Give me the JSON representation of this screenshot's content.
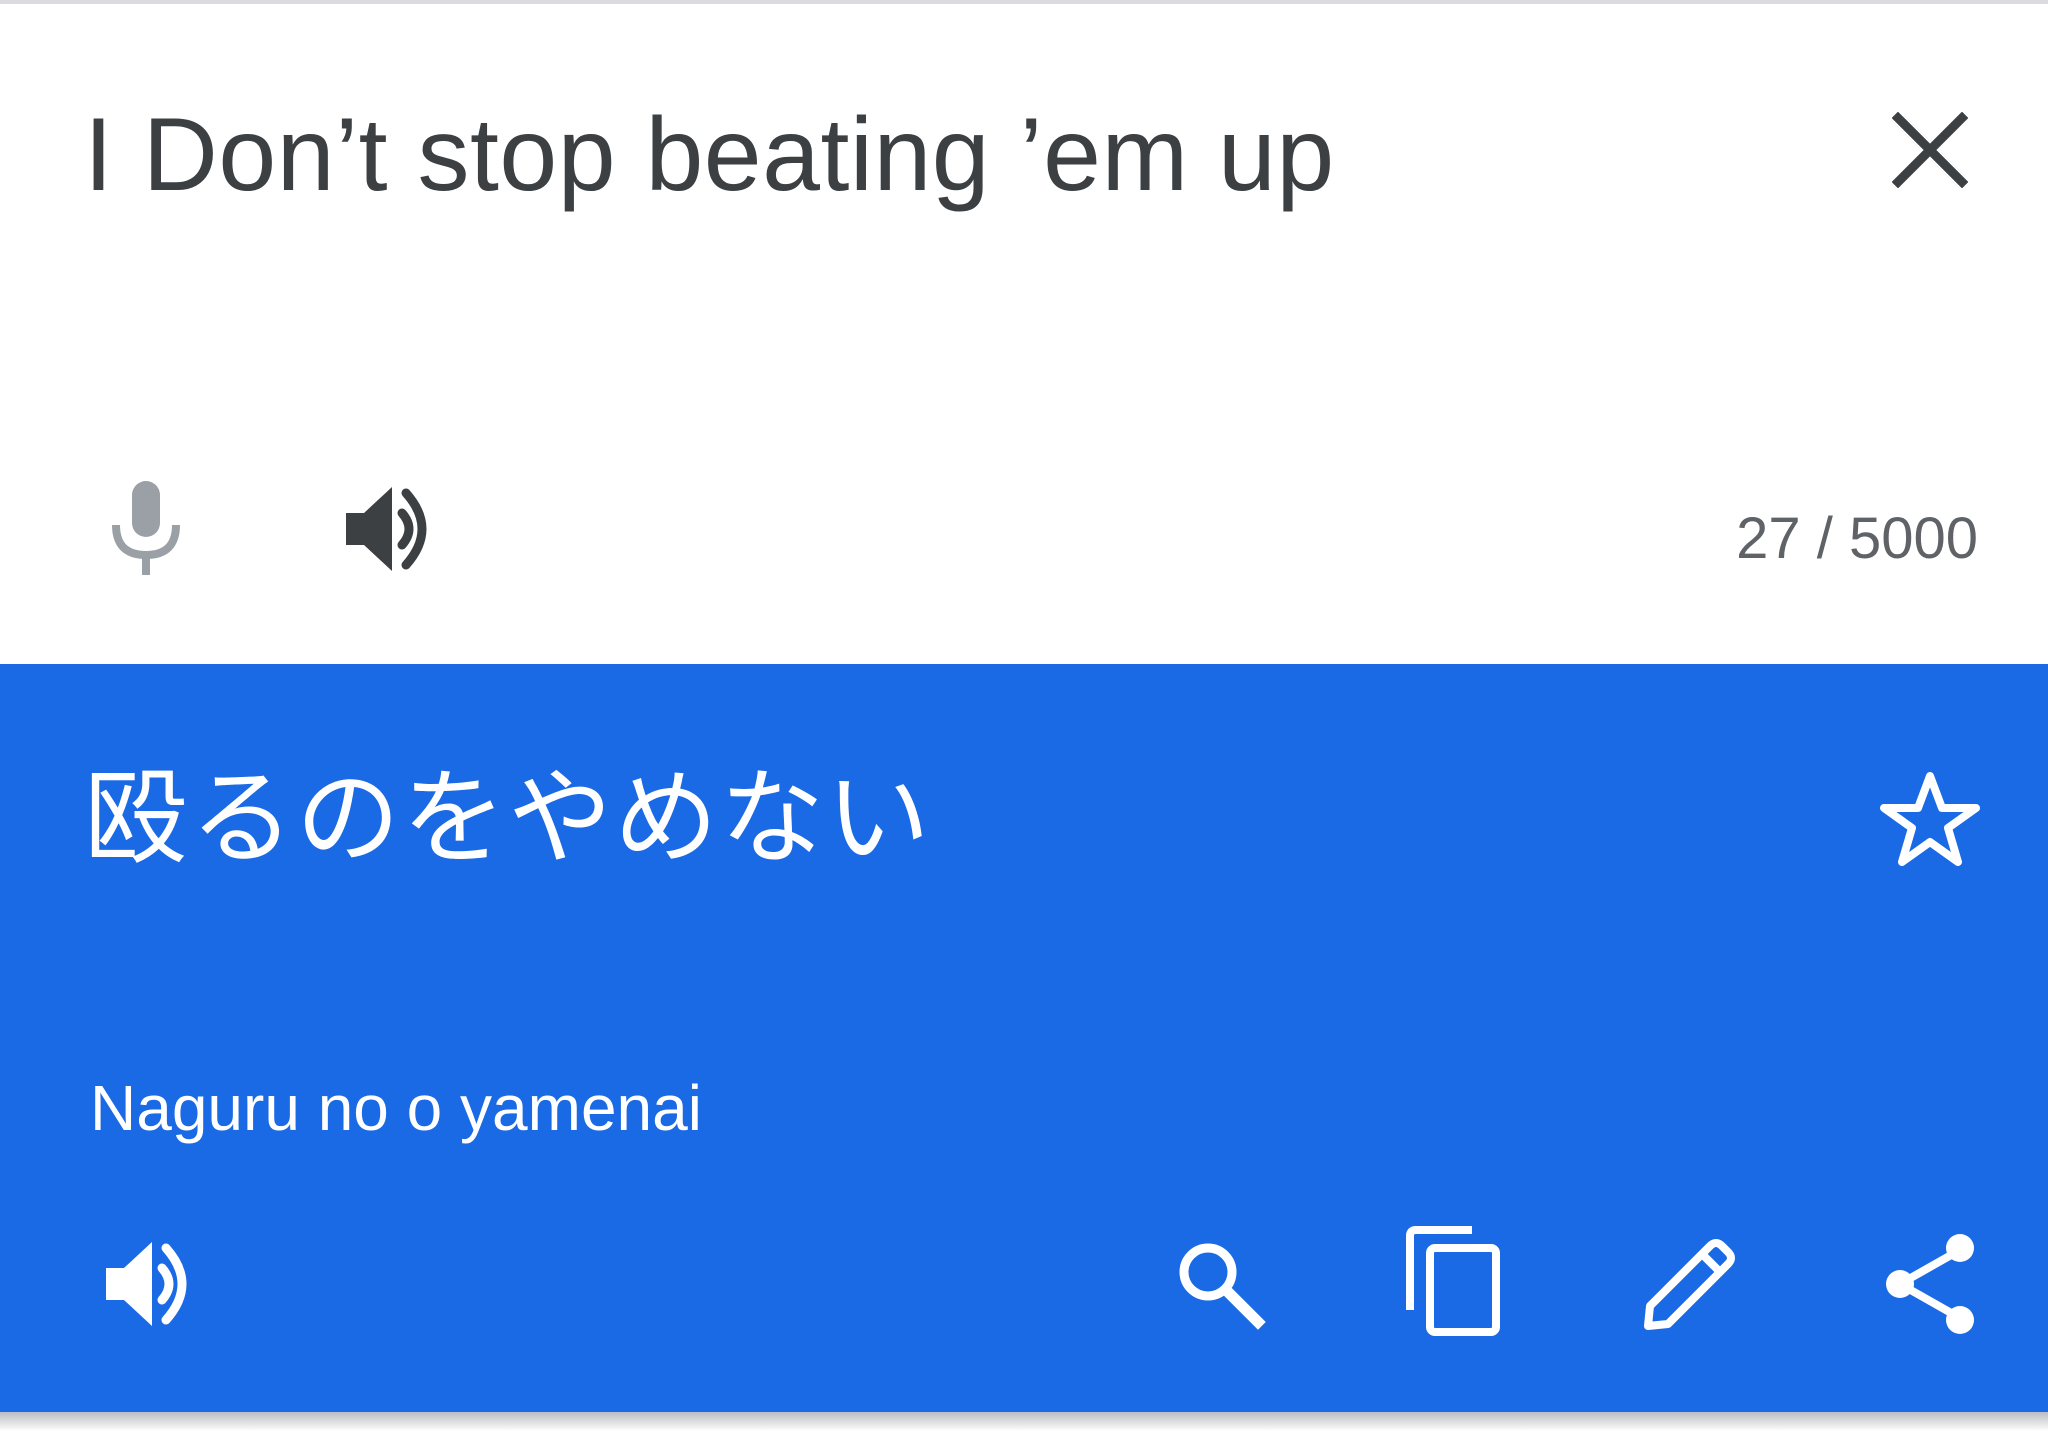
{
  "source": {
    "text": "I Don’t stop beating ’em up",
    "char_count": "27 / 5000",
    "icons": {
      "close": "close-icon",
      "mic": "microphone-icon",
      "speaker": "speaker-icon"
    }
  },
  "translation": {
    "text": "殴るのをやめない",
    "transliteration": "Naguru no o yamenai",
    "icons": {
      "star": "star-outline-icon",
      "speaker": "speaker-icon",
      "search": "search-icon",
      "copy": "copy-icon",
      "edit": "pencil-icon",
      "share": "share-icon"
    }
  },
  "colors": {
    "translation_bg": "#1a69e5",
    "source_text": "#3c4043",
    "mic_disabled": "#9aa0a6",
    "icon_dark": "#3c4043",
    "on_blue": "#ffffff"
  }
}
